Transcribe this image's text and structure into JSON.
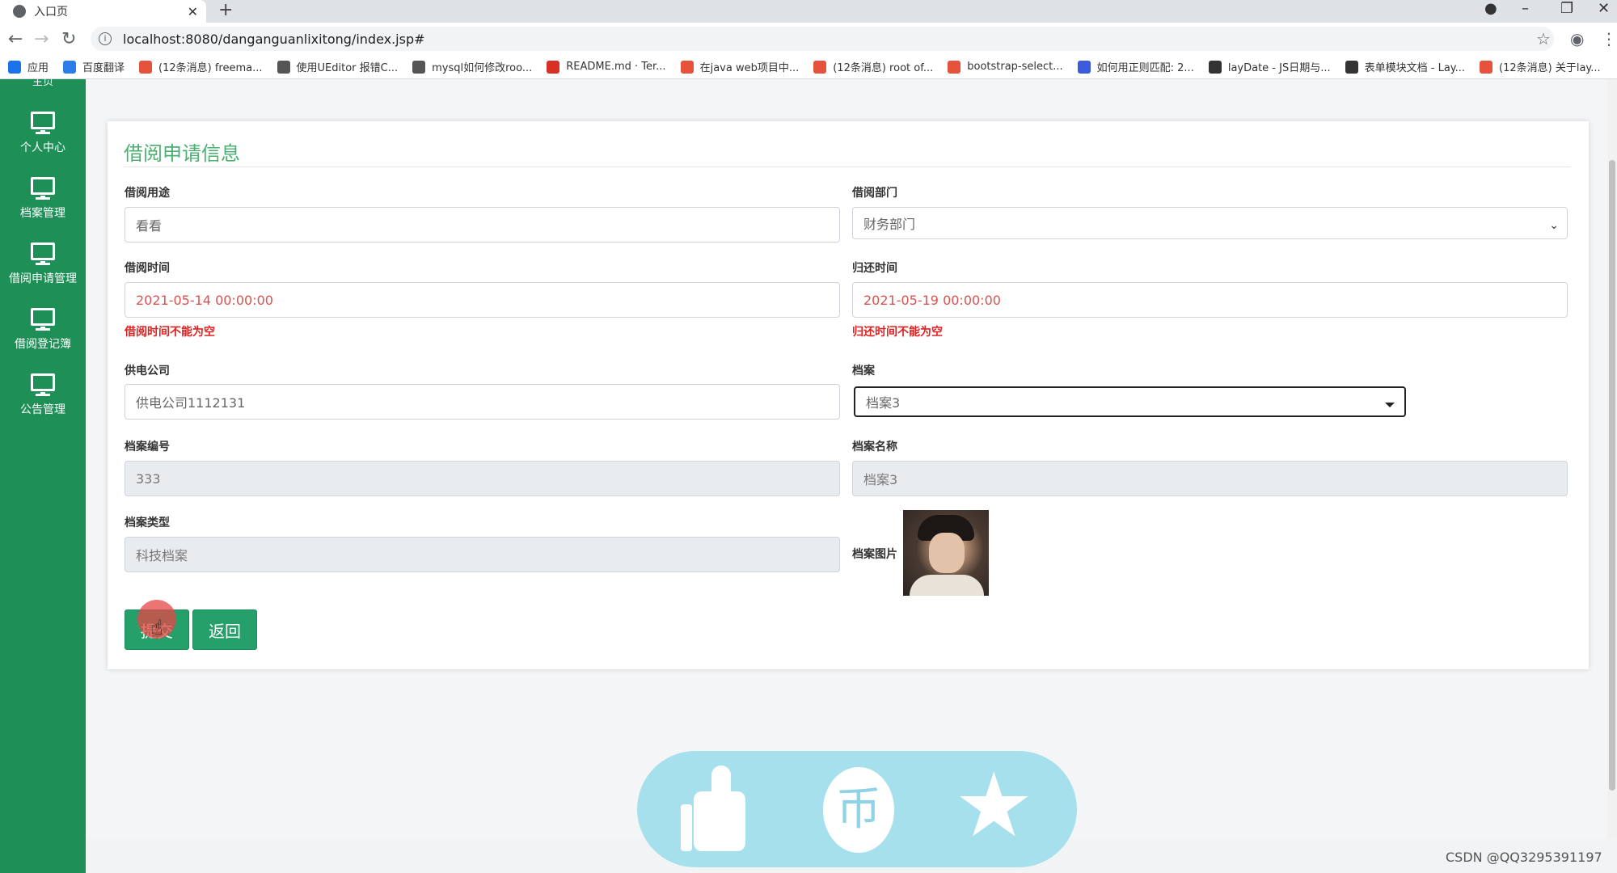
{
  "browser": {
    "tab_title": "入口页",
    "new_tab": "+",
    "url": "localhost:8080/danganguanlixitong/index.jsp#",
    "bookmarks": [
      {
        "label": "应用",
        "color": "#1a73e8"
      },
      {
        "label": "百度翻译",
        "color": "#2b7de9"
      },
      {
        "label": "(12条消息) freema...",
        "color": "#e5533d"
      },
      {
        "label": "使用UEditor 报错C...",
        "color": "#555555"
      },
      {
        "label": "mysql如何修改roo...",
        "color": "#555555"
      },
      {
        "label": "README.md · Ter...",
        "color": "#d93025"
      },
      {
        "label": "在java web项目中...",
        "color": "#e5533d"
      },
      {
        "label": "(12条消息) root of...",
        "color": "#e5533d"
      },
      {
        "label": "bootstrap-select...",
        "color": "#e5533d"
      },
      {
        "label": "如何用正则匹配: 2...",
        "color": "#3b5bdb"
      },
      {
        "label": "layDate - JS日期与...",
        "color": "#333333"
      },
      {
        "label": "表单模块文档 - Lay...",
        "color": "#333333"
      },
      {
        "label": "(12条消息) 关于lay...",
        "color": "#e5533d"
      }
    ]
  },
  "sidebar": {
    "cut_label": "主页",
    "items": [
      {
        "label": "个人中心"
      },
      {
        "label": "档案管理"
      },
      {
        "label": "借阅申请管理"
      },
      {
        "label": "借阅登记簿"
      },
      {
        "label": "公告管理"
      }
    ]
  },
  "form": {
    "title": "借阅申请信息",
    "purpose": {
      "label": "借阅用途",
      "value": "看看"
    },
    "department": {
      "label": "借阅部门",
      "value": "财务部门"
    },
    "borrow_time": {
      "label": "借阅时间",
      "value": "2021-05-14 00:00:00",
      "error": "借阅时间不能为空"
    },
    "return_time": {
      "label": "归还时间",
      "value": "2021-05-19 00:00:00",
      "error": "归还时间不能为空"
    },
    "company": {
      "label": "供电公司",
      "value": "供电公司1112131"
    },
    "archive": {
      "label": "档案",
      "value": "档案3"
    },
    "archive_no": {
      "label": "档案编号",
      "value": "333"
    },
    "archive_name": {
      "label": "档案名称",
      "value": "档案3"
    },
    "archive_type": {
      "label": "档案类型",
      "value": "科技档案"
    },
    "archive_image": {
      "label": "档案图片"
    },
    "submit_label": "提交",
    "back_label": "返回"
  },
  "float_bar": {
    "coin_glyph": "币"
  },
  "watermark": "CSDN @QQ3295391197",
  "colors": {
    "sidebar": "#1e8f57",
    "accent": "#26a06a",
    "title": "#4caf72",
    "error": "#dd2222",
    "pill": "#a7e0ed"
  }
}
